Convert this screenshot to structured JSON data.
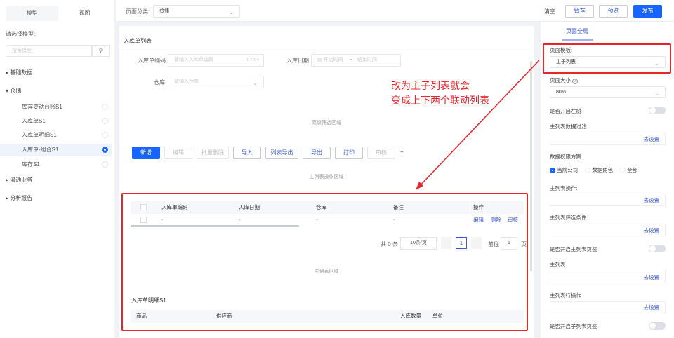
{
  "sidebar": {
    "tabs": [
      "模型",
      "视图"
    ],
    "select_label": "请选择模型:",
    "search_placeholder": "搜索模型",
    "groups": [
      {
        "label": "基础数据",
        "expanded": false
      },
      {
        "label": "仓储",
        "expanded": true
      },
      {
        "label": "流通业务",
        "expanded": false
      },
      {
        "label": "分析报告",
        "expanded": false
      }
    ],
    "children": [
      {
        "label": "库存变动台账S1",
        "selected": false
      },
      {
        "label": "入库单S1",
        "selected": false
      },
      {
        "label": "入库单明细S1",
        "selected": false
      },
      {
        "label": "入库单-组合S1",
        "selected": true
      },
      {
        "label": "库存S1",
        "selected": false
      }
    ]
  },
  "topbar": {
    "category_label": "页面分类:",
    "category_value": "仓储",
    "clear": "清空",
    "save": "暂存",
    "preview": "预览",
    "publish": "发布"
  },
  "canvas": {
    "title": "入库单列表",
    "filters": {
      "code_label": "入库单编码",
      "code_placeholder": "请输入入库单编码",
      "code_count": "0 / 64",
      "date_label": "入库日期",
      "date_start": "开始时间",
      "date_sep": "-",
      "date_end": "结束时间",
      "warehouse_label": "仓库",
      "warehouse_placeholder": "请输入仓库"
    },
    "filter_area": "高级筛选区域",
    "actions": [
      {
        "label": "新增",
        "style": "primary"
      },
      {
        "label": "编辑",
        "style": "disabled"
      },
      {
        "label": "批量删除",
        "style": "disabled"
      },
      {
        "label": "导入",
        "style": "normal"
      },
      {
        "label": "列表导出",
        "style": "normal"
      },
      {
        "label": "导出",
        "style": "normal"
      },
      {
        "label": "打印",
        "style": "normal"
      },
      {
        "label": "审核",
        "style": "disabled"
      }
    ],
    "add_action": "+",
    "action_area": "主列表操作区域",
    "table": {
      "headers": [
        "入库单编码",
        "入库日期",
        "仓库",
        "备注"
      ],
      "op_header": "操作",
      "row": [
        "-",
        "-",
        "-",
        "-"
      ],
      "row_ops": [
        "编辑",
        "删除",
        "审核"
      ]
    },
    "pagination": {
      "total": "共 0 条",
      "page_size": "10条/页",
      "current": "1",
      "goto_label": "前往",
      "goto_value": "1",
      "page_suffix": "页"
    },
    "list_area": "主列表区域",
    "sub_title": "入库单明细S1",
    "sub_headers": [
      "商品",
      "供应商",
      "入库数量",
      "单位"
    ]
  },
  "annotation": {
    "line1": "改为主子列表就会",
    "line2": "变成上下两个联动列表",
    "color": "#e8252b"
  },
  "panel": {
    "tab": "页面全局",
    "template_label": "页面模板:",
    "template_value": "主子列表",
    "size_label": "页面大小",
    "size_value": "80%",
    "left_tree_label": "是否开启左树",
    "filter_label": "主列表数据过滤:",
    "set_link": "去设置",
    "perm_label": "数据权限方案:",
    "perm_options": [
      {
        "label": "当前公司",
        "checked": true
      },
      {
        "label": "数据角色",
        "checked": false
      },
      {
        "label": "全部",
        "checked": false
      }
    ],
    "ops_label": "主列表操作:",
    "cond_label": "主列表筛选条件:",
    "main_tab_label": "是否开启主列表页签",
    "main_list_label": "主列表:",
    "row_ops_label": "主列表行操作:",
    "sub_tab_label": "是否开启子列表页签"
  },
  "colors": {
    "accent": "#1764ff",
    "highlight": "#e8252b"
  }
}
